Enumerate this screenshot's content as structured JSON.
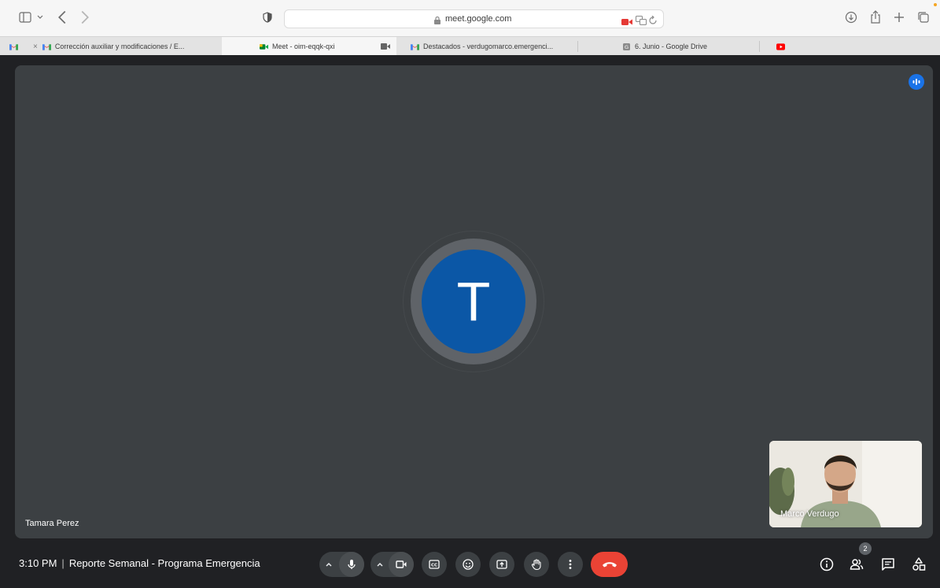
{
  "browser": {
    "url": "meet.google.com",
    "tabs": [
      {
        "label": "Corrección auxiliar y modificaciones / E...",
        "icon": "gmail-icon"
      },
      {
        "label": "Meet - oim-eqqk-qxi",
        "icon": "google-meet-icon"
      },
      {
        "label": "Destacados - verdugomarco.emergenci...",
        "icon": "gmail-icon"
      },
      {
        "label": "6. Junio - Google Drive",
        "icon": "google-drive-icon"
      },
      {
        "label": "",
        "icon": "youtube-icon"
      }
    ],
    "close_glyph": "×"
  },
  "meet": {
    "main_participant": {
      "name": "Tamara Perez",
      "initial": "T",
      "avatar_color": "#0b57a6"
    },
    "self_participant": {
      "name": "Marco Verdugo"
    },
    "time": "3:10 PM",
    "separator": "|",
    "meeting_title": "Reporte Semanal - Programa Emergencia",
    "participant_count": "2"
  },
  "colors": {
    "accent": "#1a73e8",
    "hangup": "#ea4335",
    "tile": "#3c4043",
    "background": "#202124"
  }
}
